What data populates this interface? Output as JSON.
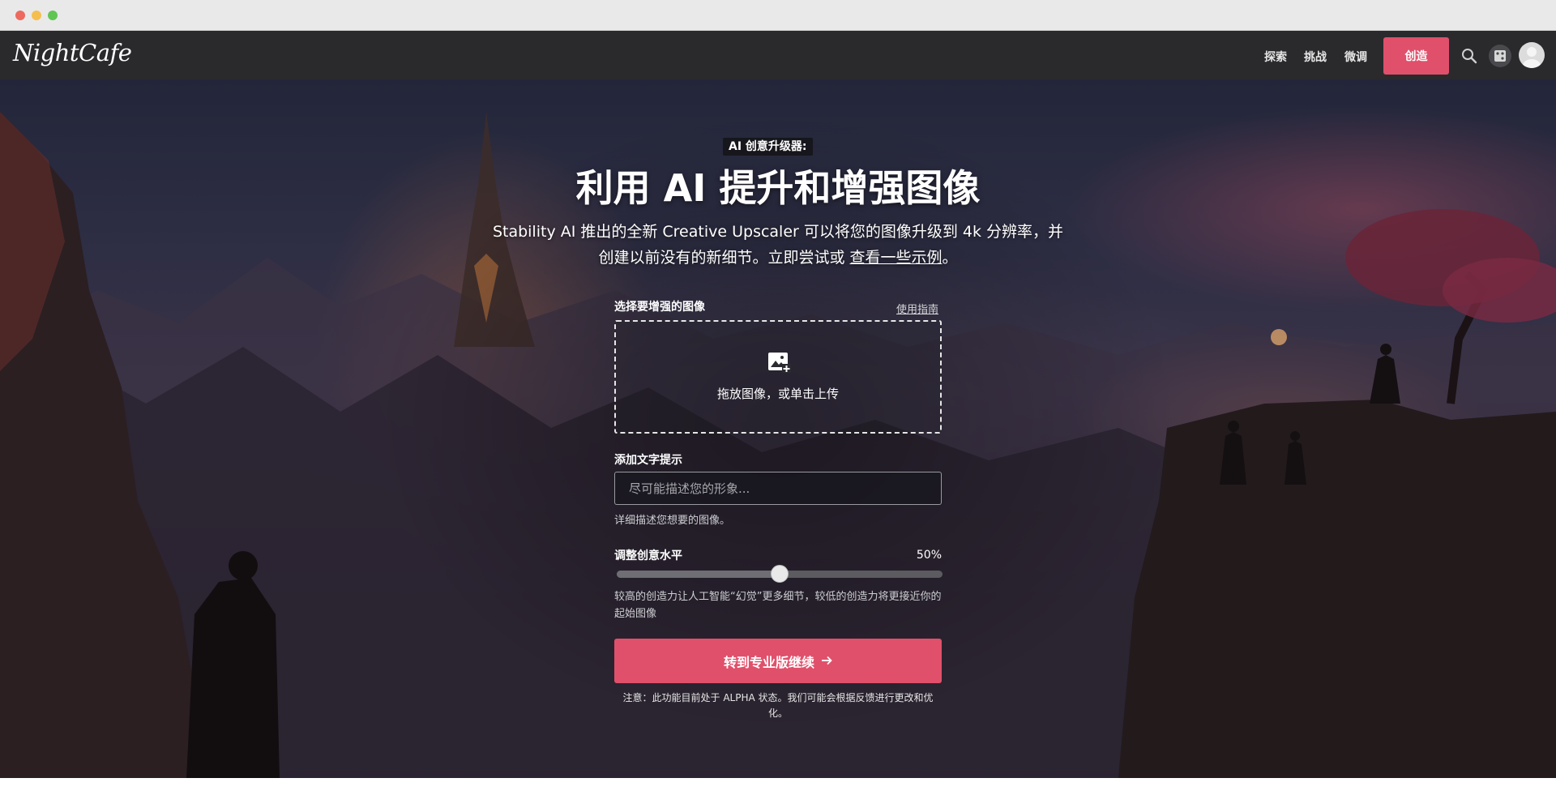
{
  "nav": {
    "logo": "NightCafe",
    "links": [
      "探索",
      "挑战",
      "微调"
    ],
    "create_label": "创造",
    "accent": "#e0506b"
  },
  "hero": {
    "eyebrow": "AI 创意升级器:",
    "headline": "利用 AI 提升和增强图像",
    "subtitle": "Stability AI 推出的全新 Creative Upscaler 可以将您的图像升级到 4k 分辨率，并创建以前没有的新细节。立即尝试或 ",
    "subtitle_link": "查看一些示例",
    "subtitle_end": "。"
  },
  "form": {
    "image_label": "选择要增强的图像",
    "guide_link": "使用指南",
    "drop_text": "拖放图像，或单击上传",
    "prompt_label": "添加文字提示",
    "prompt_placeholder": "尽可能描述您的形象...",
    "prompt_hint": "详细描述您想要的图像。",
    "creativity_label": "调整创意水平",
    "creativity_value": "50%",
    "creativity_level": 0.5,
    "creativity_hint": "较高的创造力让人工智能“幻觉”更多细节，较低的创造力将更接近你的起始图像",
    "cta_label": "转到专业版继续",
    "note": "注意：此功能目前处于 ALPHA 状态。我们可能会根据反馈进行更改和优化。"
  },
  "icons": [
    "search-icon",
    "gallery-icon",
    "avatar-icon",
    "image-upload-icon",
    "arrow-right-icon"
  ]
}
